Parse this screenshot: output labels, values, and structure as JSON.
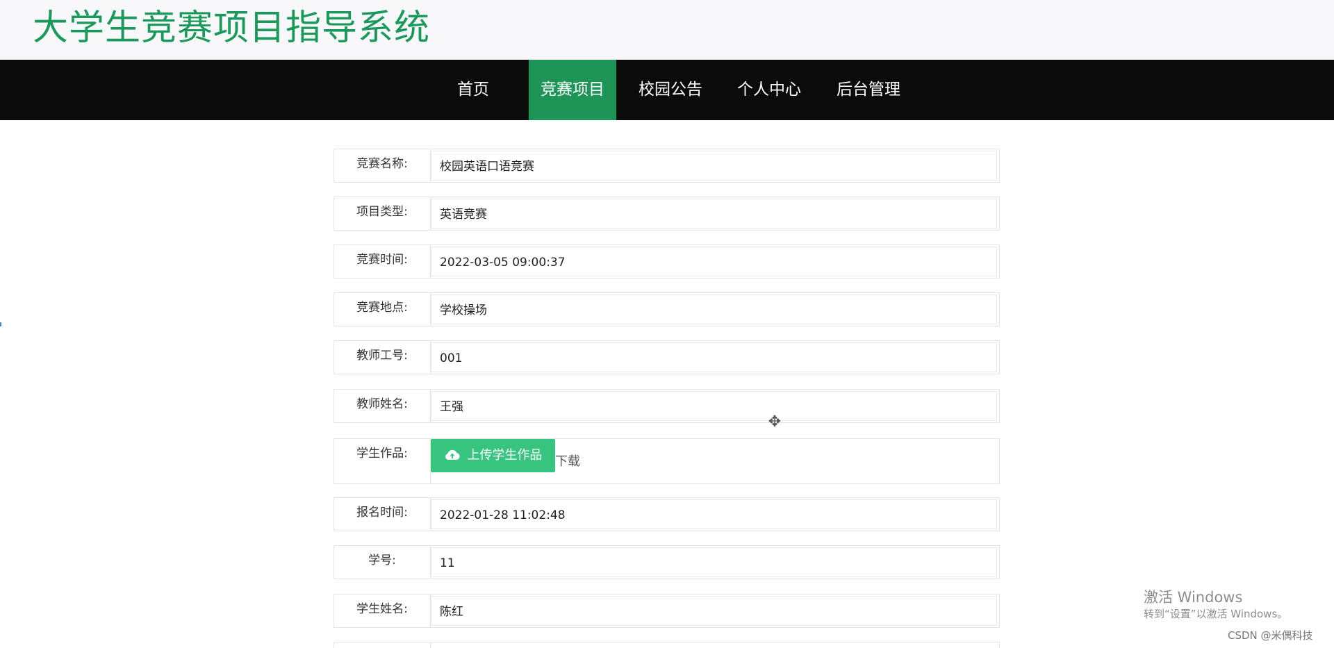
{
  "site": {
    "title": "大学生竞赛项目指导系统"
  },
  "nav": {
    "items": [
      {
        "label": "首页",
        "active": false
      },
      {
        "label": "竞赛项目",
        "active": true
      },
      {
        "label": "校园公告",
        "active": false
      },
      {
        "label": "个人中心",
        "active": false
      },
      {
        "label": "后台管理",
        "active": false
      }
    ]
  },
  "form": {
    "fields": [
      {
        "label": "竞赛名称:",
        "value": "校园英语口语竞赛"
      },
      {
        "label": "项目类型:",
        "value": "英语竞赛"
      },
      {
        "label": "竞赛时间:",
        "value": "2022-03-05 09:00:37"
      },
      {
        "label": "竞赛地点:",
        "value": "学校操场"
      },
      {
        "label": "教师工号:",
        "value": "001"
      },
      {
        "label": "教师姓名:",
        "value": "王强"
      },
      {
        "label": "学生作品:",
        "upload_label": "上传学生作品",
        "download_label": "下载"
      },
      {
        "label": "报名时间:",
        "value": "2022-01-28 11:02:48"
      },
      {
        "label": "学号:",
        "value": "11"
      },
      {
        "label": "学生姓名:",
        "value": "陈红"
      }
    ]
  },
  "watermark": {
    "line1": "激活 Windows",
    "line2": "转到“设置”以激活 Windows。"
  },
  "credit": "CSDN @米偶科技",
  "colors": {
    "brand_green": "#1a9a5a",
    "nav_active": "#1e9457",
    "upload_button": "#37c47f",
    "nav_background": "#0b0b0b"
  },
  "icons": {
    "upload": "cloud-upload-icon",
    "cursor": "move-cursor-icon"
  }
}
